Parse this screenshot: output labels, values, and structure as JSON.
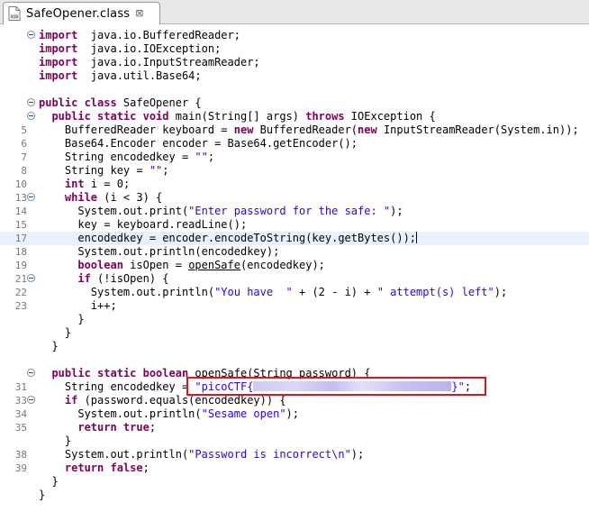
{
  "tab": {
    "title": "SafeOpener.class",
    "close_glyph": "⊠"
  },
  "lines": [
    {
      "n": "",
      "fold": true,
      "tokens": [
        [
          "kw",
          "import"
        ],
        [
          "",
          "  java.io.BufferedReader;"
        ]
      ]
    },
    {
      "n": "",
      "fold": false,
      "tokens": [
        [
          "kw",
          "import"
        ],
        [
          "",
          "  java.io.IOException;"
        ]
      ]
    },
    {
      "n": "",
      "fold": false,
      "tokens": [
        [
          "kw",
          "import"
        ],
        [
          "",
          "  java.io.InputStreamReader;"
        ]
      ]
    },
    {
      "n": "",
      "fold": false,
      "tokens": [
        [
          "kw",
          "import"
        ],
        [
          "",
          "  java.util.Base64;"
        ]
      ]
    },
    {
      "n": "",
      "fold": false,
      "tokens": []
    },
    {
      "n": "",
      "fold": true,
      "tokens": [
        [
          "kw",
          "public class"
        ],
        [
          "",
          " SafeOpener {"
        ]
      ]
    },
    {
      "n": "",
      "fold": true,
      "tokens": [
        [
          "",
          "  "
        ],
        [
          "kw",
          "public static void"
        ],
        [
          "",
          " main(String[] args) "
        ],
        [
          "kw",
          "throws"
        ],
        [
          "",
          " IOException {"
        ]
      ]
    },
    {
      "n": "5",
      "fold": false,
      "tokens": [
        [
          "",
          "    BufferedReader keyboard = "
        ],
        [
          "kw",
          "new"
        ],
        [
          "",
          " BufferedReader("
        ],
        [
          "kw",
          "new"
        ],
        [
          "",
          " InputStreamReader(System.in));"
        ]
      ]
    },
    {
      "n": "6",
      "fold": false,
      "tokens": [
        [
          "",
          "    Base64.Encoder encoder = Base64.getEncoder();"
        ]
      ]
    },
    {
      "n": "7",
      "fold": false,
      "tokens": [
        [
          "",
          "    String encodedkey = "
        ],
        [
          "str",
          "\"\""
        ],
        [
          "",
          ";"
        ]
      ]
    },
    {
      "n": "8",
      "fold": false,
      "tokens": [
        [
          "",
          "    String key = "
        ],
        [
          "str",
          "\"\""
        ],
        [
          "",
          ";"
        ]
      ]
    },
    {
      "n": "10",
      "fold": false,
      "tokens": [
        [
          "",
          "    "
        ],
        [
          "kw",
          "int"
        ],
        [
          "",
          " i = 0;"
        ]
      ]
    },
    {
      "n": "13",
      "fold": true,
      "tokens": [
        [
          "",
          "    "
        ],
        [
          "kw",
          "while"
        ],
        [
          "",
          " (i < 3) {"
        ]
      ]
    },
    {
      "n": "14",
      "fold": false,
      "tokens": [
        [
          "",
          "      System.out.print("
        ],
        [
          "str",
          "\"Enter password for the safe: \""
        ],
        [
          "",
          ");"
        ]
      ]
    },
    {
      "n": "15",
      "fold": false,
      "tokens": [
        [
          "",
          "      key = keyboard.readLine();"
        ]
      ]
    },
    {
      "n": "17",
      "fold": false,
      "current": true,
      "tokens": [
        [
          "",
          "      encodedkey = encoder.encodeToString(key.getBytes());"
        ],
        [
          "caret",
          ""
        ]
      ]
    },
    {
      "n": "18",
      "fold": false,
      "tokens": [
        [
          "",
          "      System.out.println(encodedkey);"
        ]
      ]
    },
    {
      "n": "19",
      "fold": false,
      "tokens": [
        [
          "",
          "      "
        ],
        [
          "kw",
          "boolean"
        ],
        [
          "",
          " isOpen = "
        ],
        [
          "ul",
          "openSafe"
        ],
        [
          "",
          "(encodedkey);"
        ]
      ]
    },
    {
      "n": "21",
      "fold": true,
      "tokens": [
        [
          "",
          "      "
        ],
        [
          "kw",
          "if"
        ],
        [
          "",
          " (!isOpen) {"
        ]
      ]
    },
    {
      "n": "22",
      "fold": false,
      "tokens": [
        [
          "",
          "        System.out.println("
        ],
        [
          "str",
          "\"You have  \""
        ],
        [
          "",
          " + (2 - i) + "
        ],
        [
          "str",
          "\" attempt(s) left\""
        ],
        [
          "",
          ");"
        ]
      ]
    },
    {
      "n": "23",
      "fold": false,
      "tokens": [
        [
          "",
          "        i++;"
        ]
      ]
    },
    {
      "n": "",
      "fold": false,
      "tokens": [
        [
          "",
          "      }"
        ]
      ]
    },
    {
      "n": "",
      "fold": false,
      "tokens": [
        [
          "",
          "    }"
        ]
      ]
    },
    {
      "n": "",
      "fold": false,
      "tokens": [
        [
          "",
          "  }"
        ]
      ]
    },
    {
      "n": "",
      "fold": false,
      "tokens": []
    },
    {
      "n": "",
      "fold": true,
      "tokens": [
        [
          "",
          "  "
        ],
        [
          "kw",
          "public static boolean"
        ],
        [
          "",
          " "
        ],
        [
          "ul",
          "openSafe"
        ],
        [
          "",
          "(String password) {"
        ]
      ]
    },
    {
      "n": "31",
      "fold": false,
      "tokens": [
        [
          "",
          "    String encodedkey = "
        ],
        [
          "str",
          "\"picoCTF{"
        ],
        [
          "blur",
          "220"
        ],
        [
          "str",
          "}\""
        ],
        [
          "",
          ";"
        ]
      ]
    },
    {
      "n": "33",
      "fold": true,
      "tokens": [
        [
          "",
          "    "
        ],
        [
          "kw",
          "if"
        ],
        [
          "",
          " (password.equals(encodedkey)) {"
        ]
      ]
    },
    {
      "n": "34",
      "fold": false,
      "tokens": [
        [
          "",
          "      System.out.println("
        ],
        [
          "str",
          "\"Sesame open\""
        ],
        [
          "",
          ");"
        ]
      ]
    },
    {
      "n": "35",
      "fold": false,
      "tokens": [
        [
          "",
          "      "
        ],
        [
          "kw",
          "return true"
        ],
        [
          "",
          ";"
        ]
      ]
    },
    {
      "n": "",
      "fold": false,
      "tokens": [
        [
          "",
          "    }"
        ]
      ]
    },
    {
      "n": "38",
      "fold": false,
      "tokens": [
        [
          "",
          "    System.out.println("
        ],
        [
          "str",
          "\"Password is incorrect\\n\""
        ],
        [
          "",
          ");"
        ]
      ]
    },
    {
      "n": "39",
      "fold": false,
      "tokens": [
        [
          "",
          "    "
        ],
        [
          "kw",
          "return false"
        ],
        [
          "",
          ";"
        ]
      ]
    },
    {
      "n": "",
      "fold": false,
      "tokens": [
        [
          "",
          "  }"
        ]
      ]
    },
    {
      "n": "",
      "fold": false,
      "tokens": [
        [
          "",
          "}"
        ]
      ]
    }
  ],
  "colors": {
    "keyword": "#7f0055",
    "string": "#2a00ff",
    "current_line": "#e8f2fe",
    "highlight_box": "#e0141d"
  }
}
